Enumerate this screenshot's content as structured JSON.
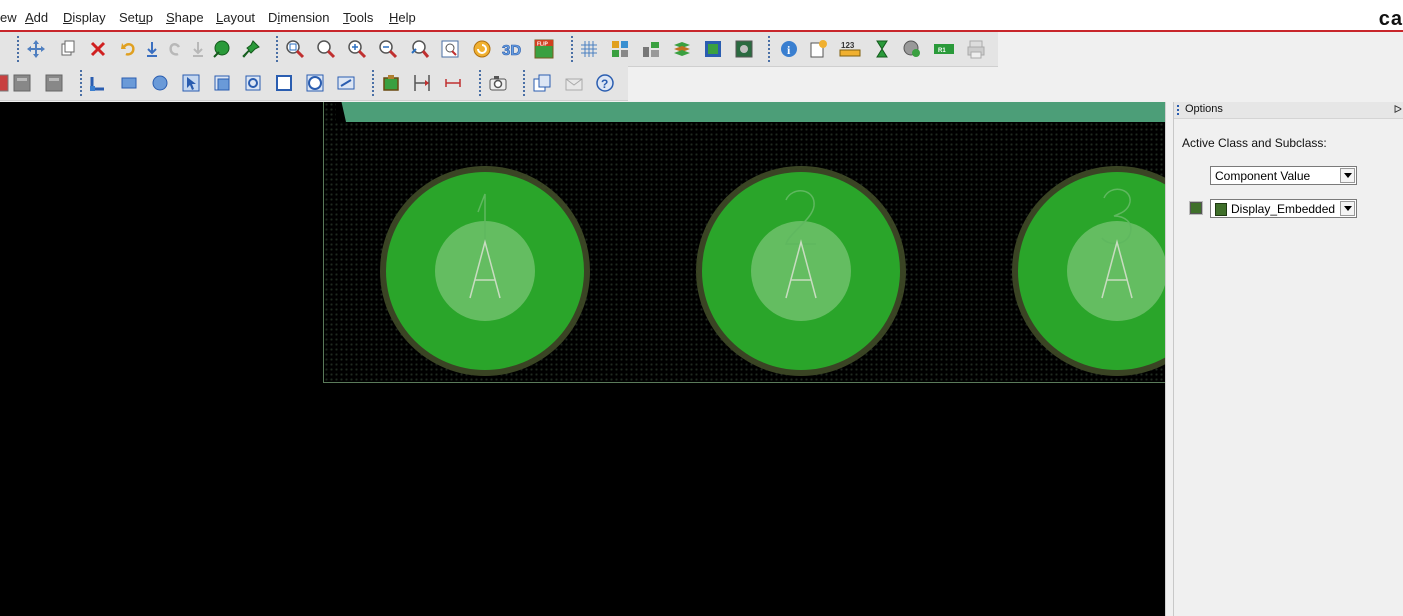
{
  "menu": {
    "items": [
      {
        "label": "ew",
        "accel": ""
      },
      {
        "label": "Add",
        "accel": "A"
      },
      {
        "label": "Display",
        "accel": "D"
      },
      {
        "label": "Setup",
        "accel": "u"
      },
      {
        "label": "Shape",
        "accel": "S"
      },
      {
        "label": "Layout",
        "accel": "L"
      },
      {
        "label": "Dimension",
        "accel": "i"
      },
      {
        "label": "Tools",
        "accel": "T"
      },
      {
        "label": "Help",
        "accel": "H"
      }
    ],
    "brand": "ca"
  },
  "toolbar1": {
    "icons": [
      "move-icon",
      "copy-icon",
      "delete-icon",
      "undo-icon",
      "place-down-icon",
      "redo-icon",
      "place-down-icon-2",
      "shape-add-icon",
      "pin-icon",
      "zoom-fit-icon",
      "zoom-area-icon",
      "zoom-in-icon",
      "zoom-out-icon",
      "zoom-previous-icon",
      "zoom-world-icon",
      "redraw-icon",
      "3d-view-icon",
      "flip-icon",
      "grid-icon",
      "color-dialog-icon",
      "layer-visibility-icon",
      "stackup-icon",
      "film-icon",
      "board-icon",
      "info-icon",
      "report-icon",
      "measure-icon",
      "hourglass-icon",
      "add-connect-icon",
      "ratsnest-icon",
      "print-icon"
    ]
  },
  "toolbar2": {
    "icons": [
      "fill-left-icon",
      "fill-center-icon",
      "fill-right-icon",
      "add-line-icon",
      "add-rectangle-icon",
      "add-circle-icon",
      "select-icon",
      "shape-edit-icon",
      "shape-void-icon",
      "rect-outline-icon",
      "circle-outline-icon",
      "shape-merge-icon",
      "place-component-icon",
      "dimension-icon",
      "measure-dim-icon",
      "camera-icon",
      "copy-window-icon",
      "mail-icon",
      "help-icon"
    ]
  },
  "options": {
    "title": "Options",
    "active_label": "Active Class and Subclass:",
    "class_value": "Component Value",
    "subclass_value": "Display_Embedded",
    "subclass_color": "#3f6f2a"
  },
  "canvas": {
    "pads": [
      {
        "label": "1"
      },
      {
        "label": "2"
      },
      {
        "label": "3"
      }
    ],
    "pad_color": "#2aa52a",
    "board_strip_color": "#4c9e78"
  }
}
